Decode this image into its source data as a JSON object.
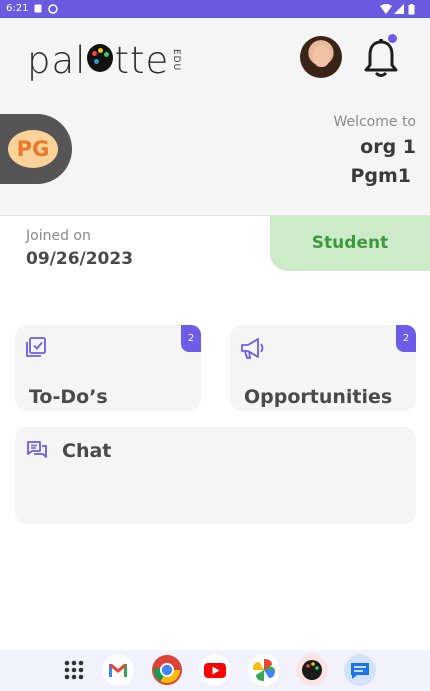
{
  "status_bar": {
    "time": "6:21"
  },
  "header": {
    "logo_text_left": "pal",
    "logo_text_right": "tte",
    "logo_suffix": "EDU"
  },
  "org": {
    "initials": "PG",
    "welcome": "Welcome to",
    "org_name": "org 1",
    "program": "Pgm1"
  },
  "profile": {
    "joined_label": "Joined on",
    "joined_date": "09/26/2023",
    "role": "Student"
  },
  "cards": {
    "todo": {
      "label": "To-Do’s",
      "count": "2"
    },
    "opportunities": {
      "label": "Opportunities",
      "count": "2"
    },
    "chat": {
      "label": "Chat"
    }
  },
  "dock": {
    "apps": [
      "apps-grid-icon",
      "gmail-icon",
      "chrome-icon",
      "youtube-icon",
      "photos-icon",
      "palette-app-icon",
      "messages-icon"
    ]
  },
  "colors": {
    "accent": "#6c5ce7",
    "status_bar": "#6a5ae0",
    "role_bg": "#cdebc9",
    "role_text": "#3c9a3c",
    "initials_bg": "#fbd29a",
    "initials_text": "#ea7a2a"
  }
}
